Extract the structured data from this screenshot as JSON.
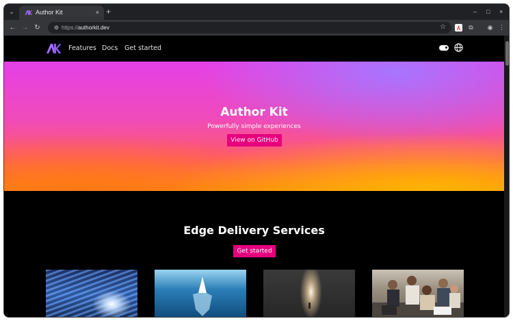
{
  "browser": {
    "tab": {
      "title": "Author Kit",
      "close_icon": "×"
    },
    "new_tab_icon": "+",
    "window_controls": {
      "minimize": "–",
      "maximize": "□",
      "close": "×"
    },
    "address": {
      "scheme": "https://",
      "host": "authorkit.dev"
    }
  },
  "site": {
    "logo_alt": "AK",
    "nav": [
      {
        "label": "Features"
      },
      {
        "label": "Docs"
      },
      {
        "label": "Get started"
      }
    ],
    "hero": {
      "title": "Author Kit",
      "subtitle": "Powerfully simple experiences",
      "button": "View on GitHub"
    },
    "section": {
      "title": "Edge Delivery Services",
      "button": "Get started"
    },
    "cards": [
      {
        "image": "light-speed-tunnel"
      },
      {
        "image": "iceberg"
      },
      {
        "image": "doorway-light"
      },
      {
        "image": "team-meeting"
      }
    ]
  },
  "colors": {
    "accent": "#e6007e",
    "page_bg": "#000000",
    "browser_frame": "#202124",
    "toolbar": "#35363a"
  }
}
